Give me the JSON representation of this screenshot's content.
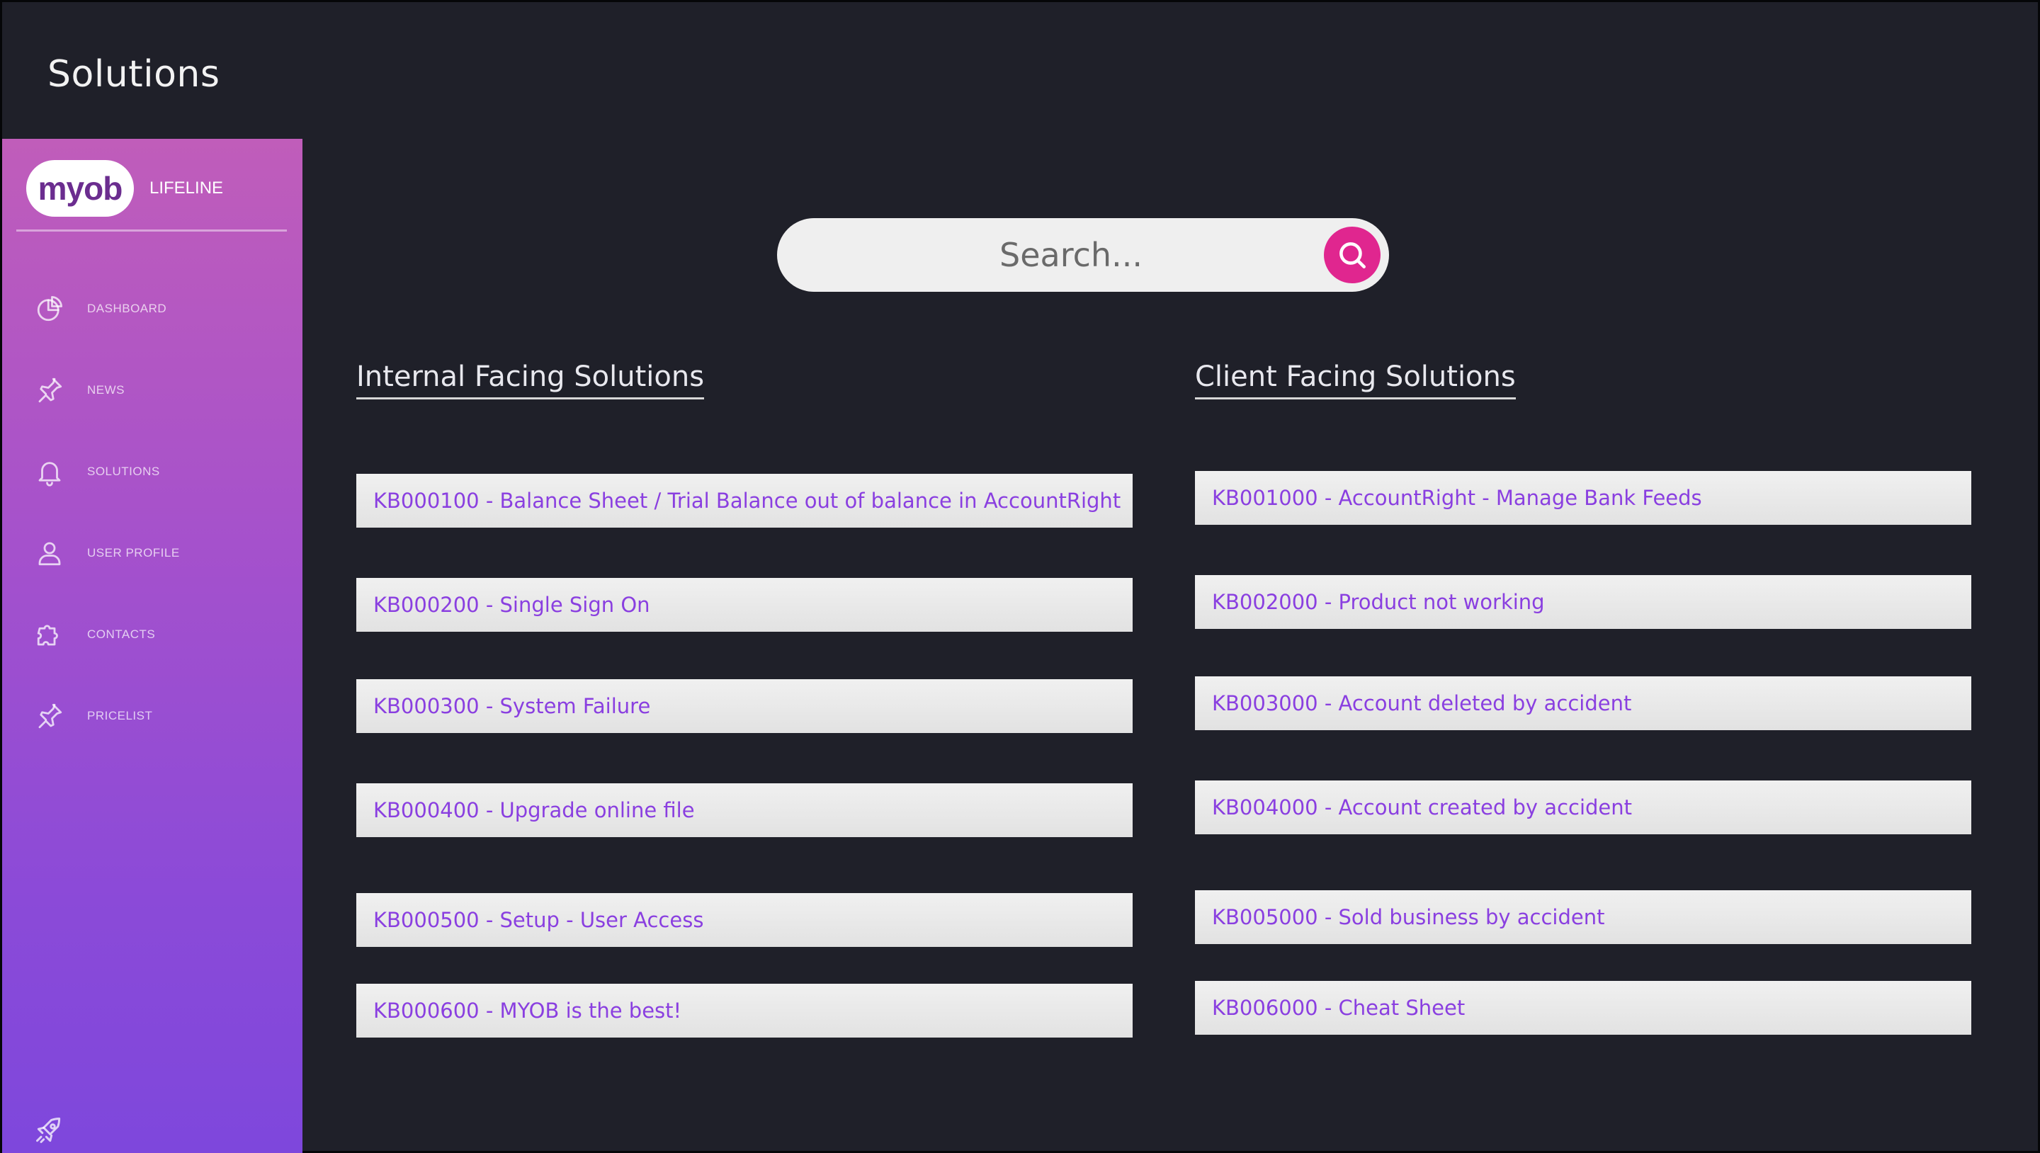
{
  "page": {
    "title": "Solutions"
  },
  "brand": {
    "logo": "myob",
    "subtitle": "LIFELINE"
  },
  "sidebar": {
    "items": [
      {
        "label": "DASHBOARD",
        "icon": "chart-pie-icon"
      },
      {
        "label": "NEWS",
        "icon": "pin-icon"
      },
      {
        "label": "SOLUTIONS",
        "icon": "bell-icon"
      },
      {
        "label": "USER PROFILE",
        "icon": "user-icon"
      },
      {
        "label": "CONTACTS",
        "icon": "puzzle-icon"
      },
      {
        "label": "PRICELIST",
        "icon": "pin-icon"
      }
    ],
    "footer_icon": "rocket-icon"
  },
  "search": {
    "placeholder": "Search...",
    "icon": "search-icon",
    "accent": "#e0268f"
  },
  "internal": {
    "title": "Internal Facing Solutions",
    "items": [
      "KB000100 - Balance Sheet / Trial Balance out of balance in AccountRight",
      "KB000200 - Single Sign On",
      "KB000300 - System Failure",
      "KB000400 - Upgrade online file",
      "KB000500 - Setup - User Access",
      "KB000600 - MYOB is the best!"
    ]
  },
  "client": {
    "title": "Client Facing Solutions",
    "items": [
      "KB001000 - AccountRight - Manage Bank Feeds",
      "KB002000 - Product not working",
      "KB003000 - Account deleted by accident",
      "KB004000 - Account created by accident",
      "KB005000 - Sold business by accident",
      "KB006000 - Cheat Sheet"
    ]
  },
  "colors": {
    "background": "#1f2029",
    "sidebar_top": "#c05dba",
    "sidebar_bottom": "#7e47dc",
    "link_text": "#8a3fe0"
  }
}
